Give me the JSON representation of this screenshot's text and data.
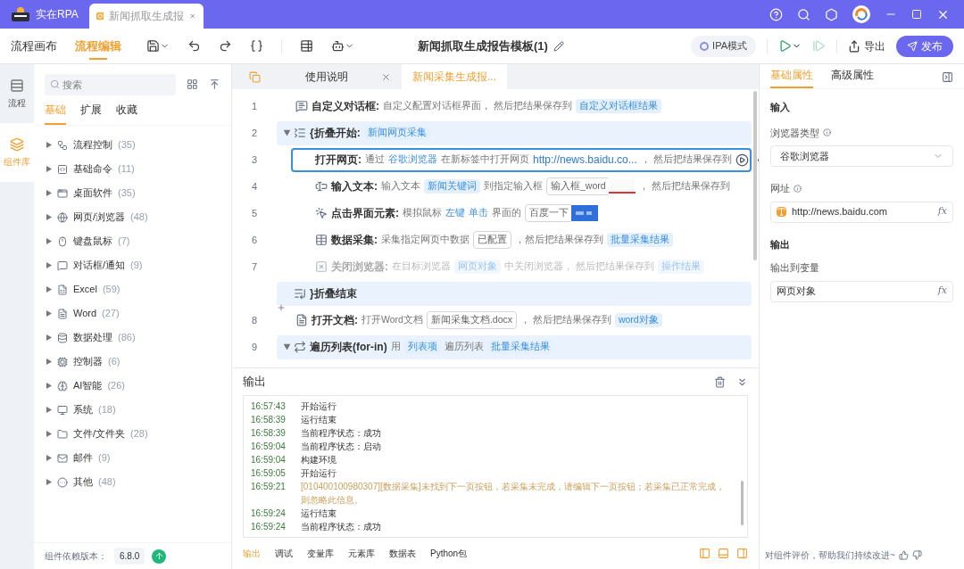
{
  "title_bar": {
    "app_name": "实在RPA",
    "tabs": [
      {
        "label": "新闻抓取生成报",
        "selected": true
      }
    ]
  },
  "toolbar": {
    "views": [
      {
        "label": "流程画布",
        "selected": false
      },
      {
        "label": "流程编辑",
        "selected": true
      }
    ],
    "document_title": "新闻抓取生成报告模板(1)",
    "mode_chip": "IPA模式",
    "export": "导出",
    "publish": "发布"
  },
  "rail": [
    {
      "label": "流程",
      "selected": false
    },
    {
      "label": "组件库",
      "selected": true
    }
  ],
  "library": {
    "search": {
      "placeholder": "搜索"
    },
    "tabs": [
      {
        "label": "基础",
        "selected": true
      },
      {
        "label": "扩展",
        "selected": false
      },
      {
        "label": "收藏",
        "selected": false
      }
    ],
    "items": [
      {
        "label": "流程控制",
        "count": "(35)",
        "expanded": false
      },
      {
        "label": "基础命令",
        "count": "(11)",
        "expanded": false
      },
      {
        "label": "桌面软件",
        "count": "(35)",
        "expanded": false
      },
      {
        "label": "网页/浏览器",
        "count": "(48)",
        "expanded": false
      },
      {
        "label": "键盘鼠标",
        "count": "(7)",
        "expanded": false
      },
      {
        "label": "对话框/通知",
        "count": "(9)",
        "expanded": false
      },
      {
        "label": "Excel",
        "count": "(59)",
        "expanded": false
      },
      {
        "label": "Word",
        "count": "(27)",
        "expanded": false
      },
      {
        "label": "数据处理",
        "count": "(86)",
        "expanded": false
      },
      {
        "label": "控制器",
        "count": "(6)",
        "expanded": false
      },
      {
        "label": "AI智能",
        "count": "(26)",
        "expanded": false
      },
      {
        "label": "系统",
        "count": "(18)",
        "expanded": false
      },
      {
        "label": "文件/文件夹",
        "count": "(28)",
        "expanded": false
      },
      {
        "label": "邮件",
        "count": "(9)",
        "expanded": false
      },
      {
        "label": "其他",
        "count": "(48)",
        "expanded": false
      }
    ],
    "version_label": "组件依赖版本：",
    "version": "6.8.0"
  },
  "editor": {
    "tabs": [
      {
        "label": "使用说明",
        "selected": false,
        "closable": true
      },
      {
        "label": "新闻采集生成报...",
        "selected": true,
        "closable": false
      }
    ],
    "rows": [
      {
        "kind": "action",
        "line": "1",
        "title": "自定义对话框:",
        "selected": false,
        "disabled": false,
        "parts": [
          {
            "kind": "text",
            "text": "自定义配置对话框界面，  然后把结果保存到"
          },
          {
            "kind": "var",
            "text": "自定义对话框结果"
          }
        ]
      },
      {
        "kind": "fold_start",
        "line": "2",
        "title": "{折叠开始:",
        "expanded": true,
        "selected": false,
        "disabled": false,
        "parts": [
          {
            "kind": "var",
            "text": "新闻网页采集"
          }
        ],
        "children": [
          {
            "kind": "action",
            "line": "3",
            "title": "打开网页:",
            "selected": true,
            "disabled": false,
            "parts": [
              {
                "kind": "text",
                "text": "通过"
              },
              {
                "kind": "keyword",
                "text": "谷歌浏览器"
              },
              {
                "kind": "text",
                "text": "在新标签中打开网页"
              },
              {
                "kind": "link",
                "text": "http://news.baidu.co..."
              },
              {
                "kind": "text",
                "text": "，  然后把结果保存到"
              }
            ]
          },
          {
            "kind": "action",
            "line": "4",
            "title": "输入文本:",
            "selected": false,
            "disabled": false,
            "parts": [
              {
                "kind": "text",
                "text": "输入文本"
              },
              {
                "kind": "var",
                "text": "新闻关键词"
              },
              {
                "kind": "text",
                "text": "到指定输入框"
              },
              {
                "kind": "field",
                "text": "输入框_word"
              },
              {
                "kind": "input_preview"
              },
              {
                "kind": "text",
                "text": "，  然后把结果保存到"
              }
            ]
          },
          {
            "kind": "action",
            "line": "5",
            "title": "点击界面元素:",
            "selected": false,
            "disabled": false,
            "parts": [
              {
                "kind": "text",
                "text": "模拟鼠标"
              },
              {
                "kind": "keyword",
                "text": "左键"
              },
              {
                "kind": "keyword",
                "text": "单击"
              },
              {
                "kind": "text",
                "text": "界面的"
              },
              {
                "kind": "field",
                "text": "百度一下"
              },
              {
                "kind": "button_preview"
              }
            ]
          },
          {
            "kind": "action",
            "line": "6",
            "title": "数据采集:",
            "selected": false,
            "disabled": false,
            "parts": [
              {
                "kind": "text",
                "text": "采集指定网页中数据"
              },
              {
                "kind": "field",
                "text": "已配置"
              },
              {
                "kind": "text",
                "text": "，然后把结果保存到"
              },
              {
                "kind": "var",
                "text": "批量采集结果"
              }
            ]
          },
          {
            "kind": "action",
            "line": "7",
            "title": "关闭浏览器:",
            "selected": false,
            "disabled": true,
            "parts": [
              {
                "kind": "text",
                "text": "在目标浏览器"
              },
              {
                "kind": "var",
                "text": "网页对象"
              },
              {
                "kind": "text",
                "text": "中关闭浏览器，  然后把结果保存到"
              },
              {
                "kind": "var",
                "text": "操作结果"
              }
            ]
          }
        ]
      },
      {
        "kind": "fold_end",
        "title": "}折叠结束",
        "selected": false,
        "disabled": false,
        "parts": []
      },
      {
        "kind": "action",
        "line": "8",
        "title": "打开文档:",
        "selected": false,
        "disabled": false,
        "parts": [
          {
            "kind": "text",
            "text": "打开Word文档"
          },
          {
            "kind": "field",
            "text": "新闻采集文档.docx"
          },
          {
            "kind": "text",
            "text": "，  然后把结果保存到"
          },
          {
            "kind": "var",
            "text": "word对象"
          }
        ]
      },
      {
        "kind": "loop",
        "line": "9",
        "title": "遍历列表(for-in)",
        "expanded": true,
        "selected": false,
        "disabled": false,
        "parts": [
          {
            "kind": "text",
            "text": "用"
          },
          {
            "kind": "var",
            "text": "列表项"
          },
          {
            "kind": "text",
            "text": "遍历列表"
          },
          {
            "kind": "var",
            "text": "批量采集结果"
          }
        ]
      }
    ]
  },
  "output": {
    "title": "输出",
    "log": [
      {
        "time": "16:57:43",
        "message": "开始运行",
        "kind": "info"
      },
      {
        "time": "16:58:39",
        "message": "运行结束",
        "kind": "info"
      },
      {
        "time": "16:58:39",
        "message": "当前程序状态：成功",
        "kind": "info"
      },
      {
        "time": "16:59:04",
        "message": "当前程序状态：启动",
        "kind": "info"
      },
      {
        "time": "16:59:04",
        "message": "构建环境",
        "kind": "info"
      },
      {
        "time": "16:59:05",
        "message": "开始运行",
        "kind": "info"
      },
      {
        "time": "16:59:21",
        "message": "[010400100980307][数据采集]未找到下一页按钮，若采集未完成，请编辑下一页按钮；若采集已正常完成，则忽略此信息。",
        "kind": "warning"
      },
      {
        "time": "16:59:24",
        "message": "运行结束",
        "kind": "info"
      },
      {
        "time": "16:59:24",
        "message": "当前程序状态：成功",
        "kind": "info"
      }
    ],
    "bottom_tabs": [
      {
        "label": "输出",
        "selected": true
      },
      {
        "label": "调试",
        "selected": false
      },
      {
        "label": "变量库",
        "selected": false
      },
      {
        "label": "元素库",
        "selected": false
      },
      {
        "label": "数据表",
        "selected": false
      },
      {
        "label": "Python包",
        "selected": false
      }
    ],
    "feedback": "对组件评价，帮助我们持续改进~"
  },
  "properties": {
    "tabs": [
      {
        "label": "基础属性",
        "selected": true
      },
      {
        "label": "高级属性",
        "selected": false
      }
    ],
    "input_heading": "输入",
    "browser_type": {
      "label": "浏览器类型",
      "value": "谷歌浏览器"
    },
    "url": {
      "label": "网址",
      "value": "http://news.baidu.com",
      "formula": "fx"
    },
    "output_heading": "输出",
    "output_var": {
      "label": "输出到变量",
      "value": "网页对象",
      "formula": "fx"
    }
  }
}
